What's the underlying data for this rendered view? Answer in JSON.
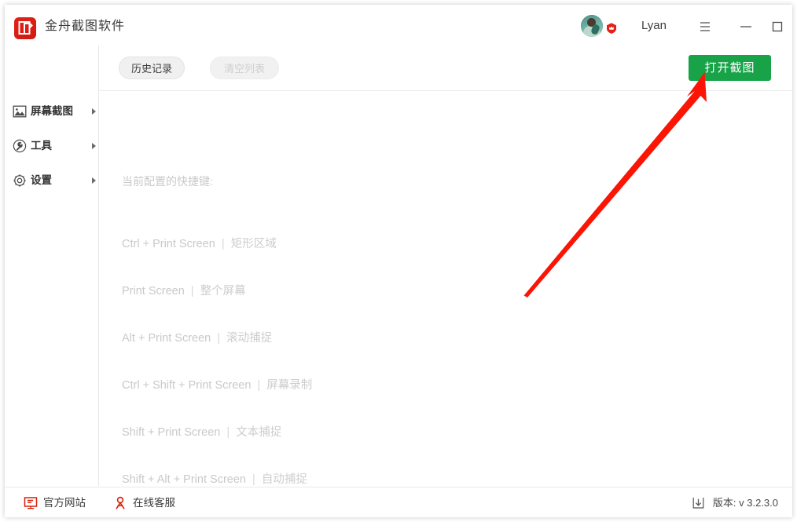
{
  "window": {
    "app_title": "金舟截图软件",
    "logo_icon": "app-logo-icon",
    "accent_green": "#18a349",
    "accent_red": "#e32119"
  },
  "titlebar": {
    "avatar_icon": "user-avatar",
    "vip_badge_icon": "vip-crown-badge-icon",
    "username": "Lyan",
    "menu_icon": "hamburger-menu-icon",
    "minimize_icon": "minimize-icon",
    "maximize_icon": "maximize-icon",
    "close_icon": "close-icon"
  },
  "sidebar": {
    "items": [
      {
        "label": "屏幕截图",
        "icon": "image-capture-icon",
        "arrow": "chevron-right-icon"
      },
      {
        "label": "工具",
        "icon": "wrench-icon",
        "arrow": "chevron-right-icon"
      },
      {
        "label": "设置",
        "icon": "gear-icon",
        "arrow": "chevron-right-icon"
      }
    ]
  },
  "toolbar": {
    "history_label": "历史记录",
    "clear_label": "清空列表",
    "capture_label": "打开截图"
  },
  "panel": {
    "hotkeys_title": "当前配置的快捷键:",
    "separator": "|",
    "hotkeys": [
      {
        "keys": "Ctrl + Print Screen",
        "action": "矩形区域"
      },
      {
        "keys": "Print Screen",
        "action": "整个屏幕"
      },
      {
        "keys": "Alt + Print Screen",
        "action": "滚动捕捉"
      },
      {
        "keys": "Ctrl + Shift + Print Screen",
        "action": "屏幕录制"
      },
      {
        "keys": "Shift + Print Screen",
        "action": "文本捕捉"
      },
      {
        "keys": "Shift + Alt + Print Screen",
        "action": "自动捕捉"
      }
    ]
  },
  "footer": {
    "site_label": "官方网站",
    "site_icon": "monitor-icon",
    "support_label": "在线客服",
    "support_icon": "person-headset-icon",
    "version_label": "版本:  v 3.2.3.0",
    "version_icon": "download-icon"
  },
  "annotation": {
    "arrow_icon": "red-pointer-arrow",
    "color": "#fb1505"
  }
}
